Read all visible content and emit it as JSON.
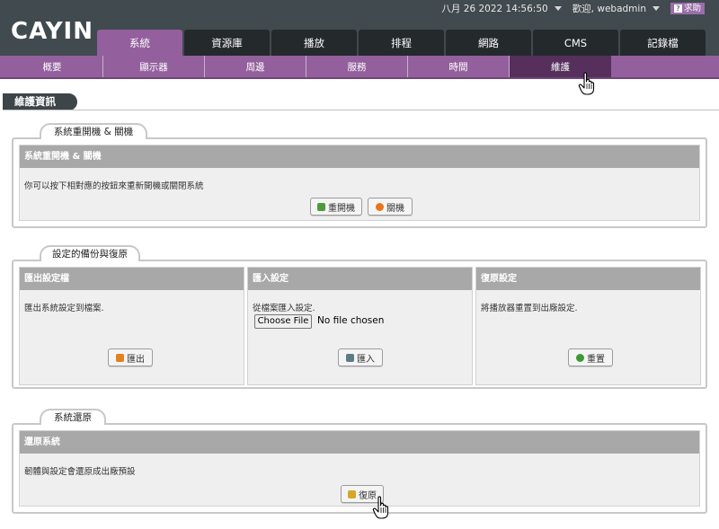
{
  "header": {
    "logo": "CAYIN",
    "datetime": "八月 26 2022 14:56:50",
    "welcome": "歡迎, webadmin",
    "help_label": "求助",
    "help_icon_glyph": "?",
    "main_tabs": [
      "系統",
      "資源庫",
      "播放",
      "排程",
      "網路",
      "CMS",
      "記錄檔"
    ],
    "active_main_tab": "系統"
  },
  "subnav": {
    "items": [
      "概要",
      "顯示器",
      "周邊",
      "服務",
      "時間",
      "維護"
    ],
    "active": "維護"
  },
  "page": {
    "title": "維護資訊"
  },
  "sections": {
    "power": {
      "tab_label": "系統重開機 & 關機",
      "panel_title": "系統重開機 & 關機",
      "description": "你可以按下相對應的按鈕來重新開機或關閉系統",
      "restart_label": "重開機",
      "shutdown_label": "關機"
    },
    "backup": {
      "tab_label": "設定的備份與復原",
      "export": {
        "title": "匯出設定檔",
        "description": "匯出系統設定到檔案.",
        "button_label": "匯出"
      },
      "import": {
        "title": "匯入設定",
        "description": "從檔案匯入設定.",
        "file_button_label": "Choose File",
        "file_status": "No file chosen",
        "button_label": "匯入"
      },
      "reset": {
        "title": "復原設定",
        "description": "將播放器重置到出廠設定.",
        "button_label": "重置"
      }
    },
    "restore": {
      "tab_label": "系統還原",
      "panel_title": "還原系統",
      "description": "韌體與設定會還原成出廠預設",
      "button_label": "復原"
    }
  },
  "colors": {
    "header_bg": "#414a4e",
    "accent_purple": "#93609d",
    "active_subtab": "#562f5c",
    "panel_head": "#a8a8a8"
  }
}
